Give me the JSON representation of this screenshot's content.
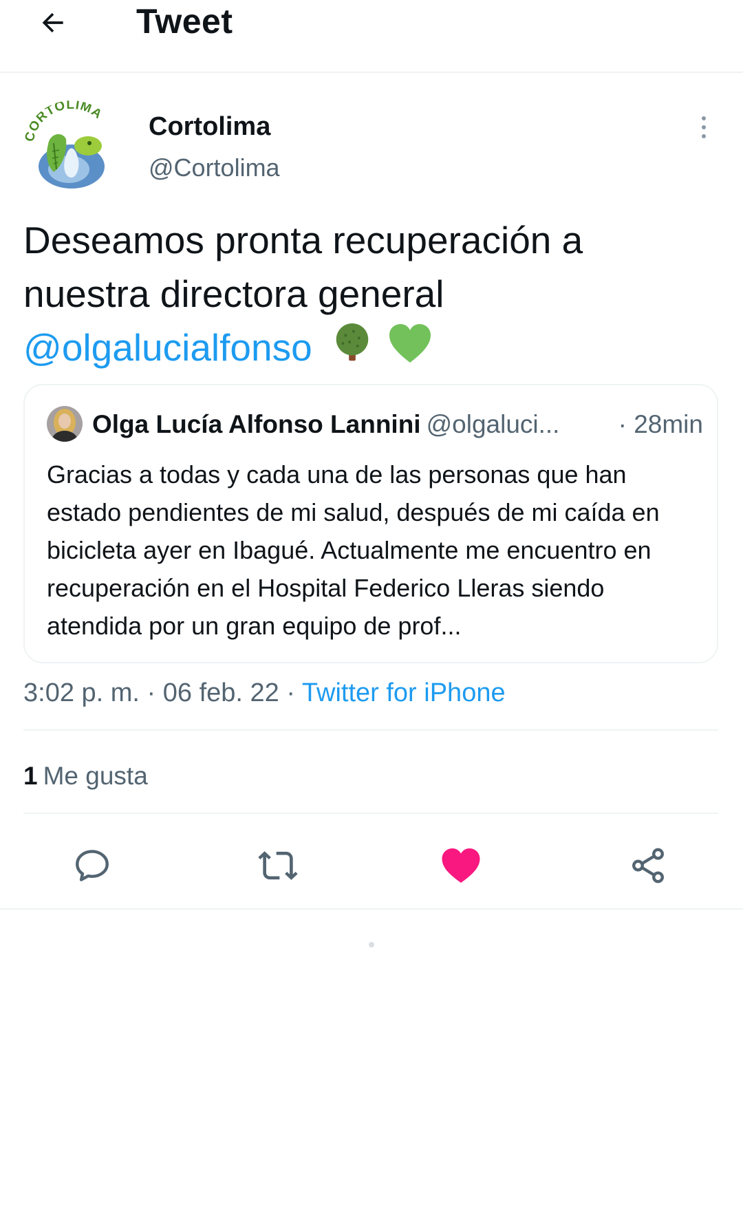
{
  "header": {
    "back_icon": "arrow-left-icon",
    "title": "Tweet"
  },
  "author": {
    "name": "Cortolima",
    "handle": "@Cortolima",
    "avatar_text": "CORTOLIMA"
  },
  "tweet": {
    "text_part1": "Deseamos pronta recuperación a nuestra directora general",
    "mention": "@olgalucialfonso",
    "emojis": [
      "tree-emoji",
      "green-heart-emoji"
    ]
  },
  "quote": {
    "name": "Olga Lucía Alfonso Lannini",
    "handle": "@olgaluci...",
    "time": "· 28min",
    "body": "Gracias a todas y cada una de las personas que han estado pendientes de mi salud, después de mi caída en bicicleta ayer en Ibagué. Actualmente me encuentro en recuperación en el Hospital Federico Lleras siendo atendida por un gran equipo de prof..."
  },
  "meta": {
    "time": "3:02 p. m.",
    "sep1": " · ",
    "date": "06 feb. 22",
    "sep2": " · ",
    "source": "Twitter for iPhone"
  },
  "stats": {
    "likes_count": "1",
    "likes_label": "Me gusta"
  },
  "actions": {
    "reply_icon": "reply-icon",
    "retweet_icon": "retweet-icon",
    "like_icon": "heart-filled-icon",
    "share_icon": "share-icon",
    "like_color": "#f91880"
  },
  "colors": {
    "link": "#1d9bf0",
    "secondary_text": "#536471",
    "border": "#eff3f4"
  }
}
